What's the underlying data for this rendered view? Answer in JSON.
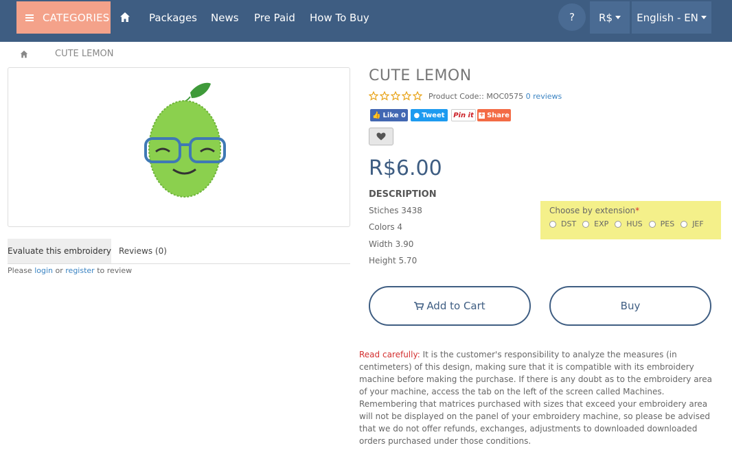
{
  "nav": {
    "categories_label": "CATEGORIES",
    "links": [
      "Packages",
      "News",
      "Pre Paid",
      "How To Buy"
    ],
    "help_label": "?",
    "currency_label": "R$",
    "language_label": "English - EN"
  },
  "breadcrumb": {
    "current": "CUTE LEMON"
  },
  "product": {
    "title": "CUTE LEMON",
    "rating": 0,
    "rating_max": 5,
    "code_text": "Product Code:: MOC0575",
    "reviews_link": "0 reviews",
    "social": {
      "like": "Like 0",
      "tweet": "Tweet",
      "pinit": "Pin it",
      "share": "Share"
    },
    "price": "R$6.00",
    "description_heading": "DESCRIPTION",
    "specs": [
      "Stiches 3438",
      "Colors 4",
      "Width 3.90",
      "Height 5.70"
    ],
    "extension": {
      "label": "Choose by extension",
      "required_mark": "*",
      "options": [
        "DST",
        "EXP",
        "HUS",
        "PES",
        "JEF"
      ]
    },
    "add_to_cart": "Add to Cart",
    "buy": "Buy"
  },
  "tabs": {
    "evaluate": "Evaluate this embroidery",
    "reviews": "Reviews (0)"
  },
  "review_note": {
    "prefix": "Please",
    "login": "login",
    "or": "or",
    "register": "register",
    "suffix": "to review"
  },
  "notice": {
    "lead": "Read carefully:",
    "body": "It is the customer's responsibility to analyze the measures (in centimeters) of this design, making sure that it is compatible with its embroidery machine before making the purchase. If there is any doubt as to the embroidery area of your machine, access the tab on the left of the screen called Machines. Remembering that matrices purchased with sizes that exceed your embroidery area will not be displayed on the panel of your embroidery machine, so please be advised that we do not offer refunds, exchanges, adjustments to downloaded downloaded orders purchased under those conditions."
  },
  "colors": {
    "nav_bg": "#3e5d82",
    "categories_bg": "#f4a28a",
    "extension_bg": "#f4f08a",
    "price": "#3e5d82",
    "link": "#3a83c2"
  }
}
